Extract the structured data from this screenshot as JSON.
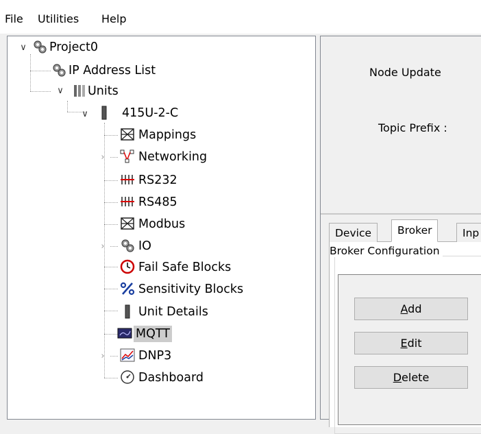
{
  "menu": {
    "file": "File",
    "utilities": "Utilities",
    "help": "Help"
  },
  "tree": {
    "project": "Project0",
    "ip_address_list": "IP Address List",
    "units": "Units",
    "unit": "415U-2-C",
    "mappings": "Mappings",
    "networking": "Networking",
    "rs232": "RS232",
    "rs485": "RS485",
    "modbus": "Modbus",
    "io": "IO",
    "fail_safe_blocks": "Fail Safe Blocks",
    "sensitivity_blocks": "Sensitivity Blocks",
    "unit_details": "Unit Details",
    "mqtt": "MQTT",
    "dnp3": "DNP3",
    "dashboard": "Dashboard",
    "selected": "MQTT"
  },
  "right": {
    "node_update_label": "Node Update",
    "topic_prefix_label": "Topic Prefix :",
    "tabs": [
      "Device",
      "Broker",
      "Inp"
    ],
    "active_tab": "Broker",
    "group_title": "Broker Configuration",
    "buttons": {
      "add_mnemonic": "A",
      "add_rest": "dd",
      "edit_mnemonic": "E",
      "edit_rest": "dit",
      "delete_mnemonic": "D",
      "delete_rest": "elete"
    }
  },
  "colors": {
    "window_bg": "#f0f0f0",
    "tree_bg": "#ffffff",
    "selection": "#cccccc",
    "button_bg": "#e1e1e1"
  }
}
